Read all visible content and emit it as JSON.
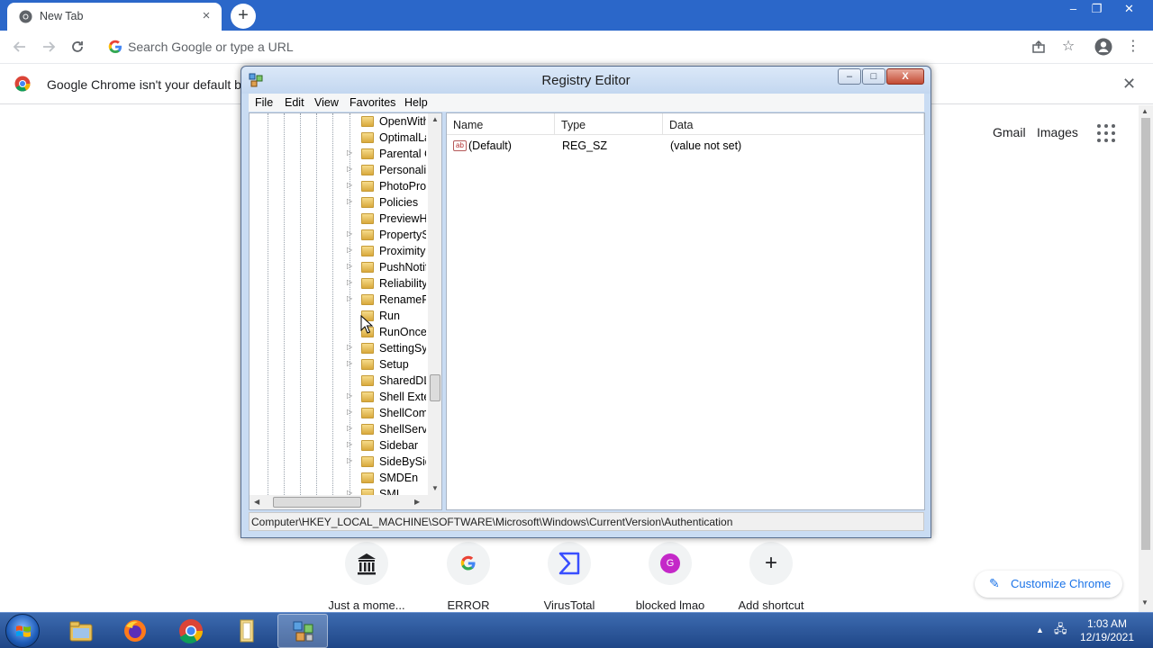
{
  "browser": {
    "tab_title": "New Tab",
    "tab_close": "×",
    "new_tab": "+",
    "window_controls": {
      "minimize": "–",
      "maximize": "❐",
      "close": "✕"
    },
    "omnibox_placeholder": "Search Google or type a URL",
    "infobar_text": "Google Chrome isn't your default bro",
    "infobar_close": "✕",
    "icons": {
      "back": "arrow-left-icon",
      "forward": "arrow-right-icon",
      "reload": "reload-icon",
      "share": "share-icon",
      "bookmark": "star-icon",
      "profile": "profile-icon",
      "menu": "kebab-menu-icon"
    }
  },
  "ntp": {
    "links": [
      "Gmail",
      "Images"
    ],
    "shortcuts": [
      {
        "label": "Just a mome...",
        "glyph": "🏛",
        "color": "#202124"
      },
      {
        "label": "ERROR",
        "glyph": "G",
        "color": "#4285f4"
      },
      {
        "label": "VirusTotal",
        "glyph": "Σ",
        "color": "#394eff"
      },
      {
        "label": "blocked lmao",
        "glyph": "G",
        "color": "#ffffff"
      },
      {
        "label": "Add shortcut",
        "glyph": "+",
        "color": "#202124"
      }
    ],
    "customize_label": "Customize Chrome"
  },
  "regedit": {
    "title": "Registry Editor",
    "controls": {
      "minimize": "–",
      "maximize": "□",
      "close": "X"
    },
    "menu": [
      "File",
      "Edit",
      "View",
      "Favorites",
      "Help"
    ],
    "tree": [
      {
        "label": "OpenWith",
        "expandable": false
      },
      {
        "label": "OptimalLa",
        "expandable": false
      },
      {
        "label": "Parental C",
        "expandable": true
      },
      {
        "label": "Personaliz",
        "expandable": true
      },
      {
        "label": "PhotoProp",
        "expandable": true
      },
      {
        "label": "Policies",
        "expandable": true
      },
      {
        "label": "PreviewHa",
        "expandable": false
      },
      {
        "label": "PropertyS",
        "expandable": true
      },
      {
        "label": "Proximity",
        "expandable": true
      },
      {
        "label": "PushNotif",
        "expandable": true
      },
      {
        "label": "Reliability",
        "expandable": true
      },
      {
        "label": "RenameFi",
        "expandable": true
      },
      {
        "label": "Run",
        "expandable": false
      },
      {
        "label": "RunOnce",
        "expandable": false
      },
      {
        "label": "SettingSyr",
        "expandable": true
      },
      {
        "label": "Setup",
        "expandable": true
      },
      {
        "label": "SharedDLI",
        "expandable": false
      },
      {
        "label": "Shell Exter",
        "expandable": true
      },
      {
        "label": "ShellCom",
        "expandable": true
      },
      {
        "label": "ShellServi",
        "expandable": true
      },
      {
        "label": "Sidebar",
        "expandable": true
      },
      {
        "label": "SideBySid",
        "expandable": true
      },
      {
        "label": "SMDEn",
        "expandable": false
      },
      {
        "label": "SMI",
        "expandable": true
      }
    ],
    "columns": [
      "Name",
      "Type",
      "Data"
    ],
    "values": [
      {
        "name": "(Default)",
        "type": "REG_SZ",
        "data": "(value not set)"
      }
    ],
    "value_icon_text": "ab",
    "status_path": "Computer\\HKEY_LOCAL_MACHINE\\SOFTWARE\\Microsoft\\Windows\\CurrentVersion\\Authentication"
  },
  "taskbar": {
    "apps": [
      "file-explorer-icon",
      "firefox-icon",
      "chrome-icon",
      "folder-icon",
      "regedit-icon"
    ],
    "clock_time": "1:03 AM",
    "clock_date": "12/19/2021",
    "tray_arrow": "▲",
    "tray_network": "🖧"
  },
  "colors": {
    "chrome_frame": "#2b67c9",
    "link_blue": "#1a73e8",
    "taskbar": "#2a5396"
  }
}
